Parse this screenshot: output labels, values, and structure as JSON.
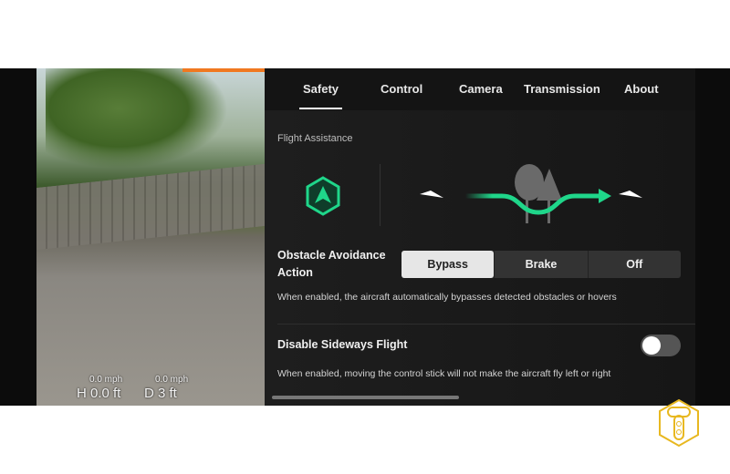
{
  "camera": {
    "horizontal_speed": "0.0 mph",
    "vertical_speed": "0.0 mph",
    "height": "H 0.0 ft",
    "distance": "D 3 ft"
  },
  "tabs": [
    {
      "label": "Safety",
      "active": true
    },
    {
      "label": "Control"
    },
    {
      "label": "Camera"
    },
    {
      "label": "Transmission"
    },
    {
      "label": "About"
    }
  ],
  "flight_assistance": {
    "title": "Flight Assistance"
  },
  "obstacle": {
    "label": "Obstacle Avoidance Action",
    "options": [
      "Bypass",
      "Brake",
      "Off"
    ],
    "selected": "Bypass",
    "description": "When enabled, the aircraft automatically bypasses detected obstacles or hovers"
  },
  "sideways": {
    "label": "Disable Sideways Flight",
    "enabled": false,
    "description": "When enabled, moving the control stick will not make the aircraft fly left or right"
  },
  "colors": {
    "accent": "#1fd68a",
    "orange": "#f07820",
    "logo": "#e8b820"
  }
}
